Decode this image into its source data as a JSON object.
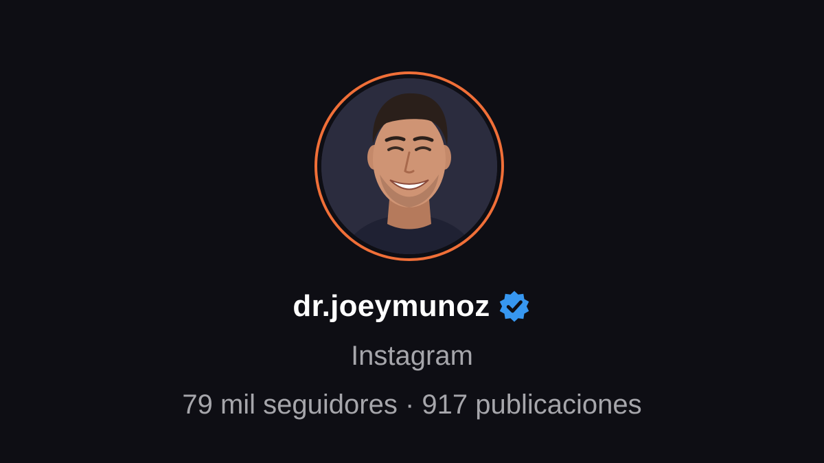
{
  "profile": {
    "username": "dr.joeymunoz",
    "verified": true,
    "platform": "Instagram",
    "followers": "79 mil seguidores",
    "separator": "·",
    "posts": "917 publicaciones",
    "avatar_icon": "profile-photo",
    "verified_icon": "verified-badge-icon"
  },
  "colors": {
    "background": "#0e0e14",
    "story_ring": "#f06f38",
    "verified_badge": "#3797f0",
    "username": "#ffffff",
    "secondary_text": "#a6a6ab"
  }
}
